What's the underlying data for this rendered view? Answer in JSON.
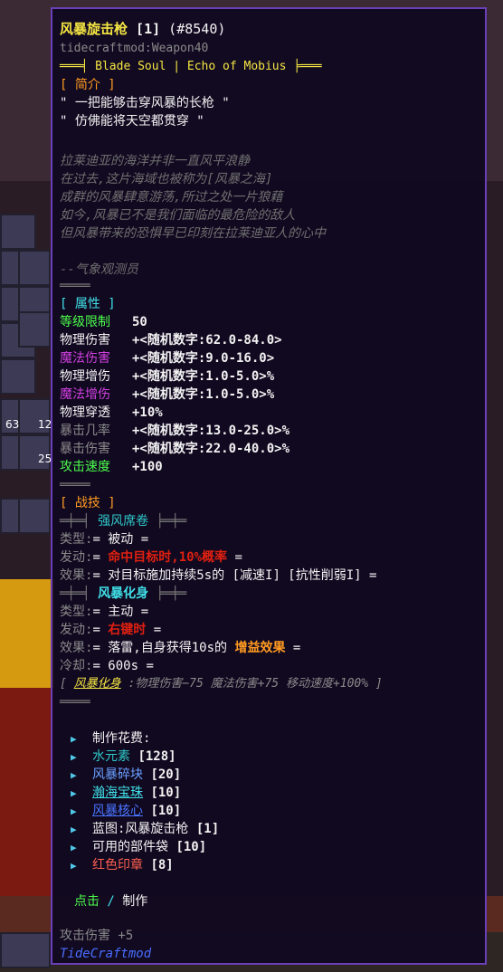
{
  "tooltip": {
    "title": "风暴旋击枪",
    "title_tag": "[1]",
    "item_id": "(#8540)",
    "internal_name": "tidecraftmod:Weapon40",
    "series_banner": "═══╡ Blade Soul | Echo of Mobius ╞═══",
    "intro_header": "[ 简介 ]",
    "quote1": "\" 一把能够击穿风暴的长枪 \"",
    "quote2": "\" 仿佛能将天空都贯穿 \"",
    "lore": [
      "拉莱迪亚的海洋并非一直风平浪静",
      "在过去,这片海域也被称为[风暴之海]",
      "成群的风暴肆意游荡,所过之处一片狼藉",
      "如今,风暴已不是我们面临的最危险的敌人",
      "但风暴带来的恐惧早已印刻在拉莱迪亚人的心中"
    ],
    "lore_source": "--气象观测员",
    "divider": "════",
    "attr_header": "[ 属性 ]",
    "stats": [
      {
        "label": "等级限制",
        "value": "50"
      },
      {
        "label": "物理伤害",
        "value": "+<随机数字:62.0-84.0>"
      },
      {
        "label": "魔法伤害",
        "value": "+<随机数字:9.0-16.0>"
      },
      {
        "label": "物理增伤",
        "value": "+<随机数字:1.0-5.0>%"
      },
      {
        "label": "魔法增伤",
        "value": "+<随机数字:1.0-5.0>%"
      },
      {
        "label": "物理穿透",
        "value": "+10%"
      },
      {
        "label": "暴击几率",
        "value": "+<随机数字:13.0-25.0>%"
      },
      {
        "label": "暴击伤害",
        "value": "+<随机数字:22.0-40.0>%"
      },
      {
        "label": "攻击速度",
        "value": "+100"
      }
    ],
    "skill_header": "[ 战技 ]",
    "skill1": {
      "banner_left": "═╪═╡",
      "name": "强风席卷",
      "banner_right": "╞═╪═",
      "type_label": "类型:",
      "type_value": "= 被动 =",
      "trigger_label": "发动:",
      "trigger_prefix": "= ",
      "trigger_value": "命中目标时,10%概率",
      "trigger_suffix": " =",
      "effect_label": "效果:",
      "effect_value": "= 对目标施加持续5s的 [减速I] [抗性削弱I] ="
    },
    "skill2": {
      "banner_left": "═╪═╡",
      "name": "风暴化身",
      "banner_right": "╞═╪═",
      "type_label": "类型:",
      "type_value": "= 主动 =",
      "trigger_label": "发动:",
      "trigger_prefix": "= ",
      "trigger_value": "右键时",
      "trigger_suffix": " =",
      "effect_label": "效果:",
      "effect_prefix": "= 落雷,自身获得10s的 ",
      "effect_highlight": "增益效果",
      "effect_suffix": " =",
      "cooldown_label": "冷却:",
      "cooldown_value": "= 600s ="
    },
    "buff_line_open": "[ ",
    "buff_name": "风暴化身",
    "buff_effects": " :物理伤害−75 魔法伤害+75 移动速度+100% ]",
    "craft_header": "制作花费:",
    "craft_items": [
      {
        "name": "水元素",
        "qty": "[128]",
        "color": "#2ec8c8"
      },
      {
        "name": "风暴碎块",
        "qty": "[20]",
        "color": "#6aa0ff"
      },
      {
        "name": "瀚海宝珠",
        "qty": "[10]",
        "color": "#40e0e8"
      },
      {
        "name": "风暴核心",
        "qty": "[10]",
        "color": "#4a74ff"
      },
      {
        "name": "蓝图:风暴旋击枪",
        "qty": "[1]",
        "color": "#f2f2f2"
      },
      {
        "name": "可用的部件袋",
        "qty": "[10]",
        "color": "#f2f2f2"
      },
      {
        "name": "红色印章",
        "qty": "[8]",
        "color": "#ff6050"
      }
    ],
    "click_label": "点击",
    "click_sep": " / ",
    "craft_label": "制作",
    "footer_stat": "攻击伤害 +5",
    "mod_name": "TideCraftmod"
  },
  "inventory": {
    "counts": [
      "63",
      "12",
      "25"
    ]
  },
  "colors": {
    "tooltip_bg": "#100820",
    "tooltip_border": "#6a3fb8",
    "title": "#f5e642",
    "stat_label_green": "#4cff4c",
    "stat_label_magenta": "#d040e0",
    "skill_trigger": "#e02010",
    "buff_highlight": "#ff9a20"
  }
}
